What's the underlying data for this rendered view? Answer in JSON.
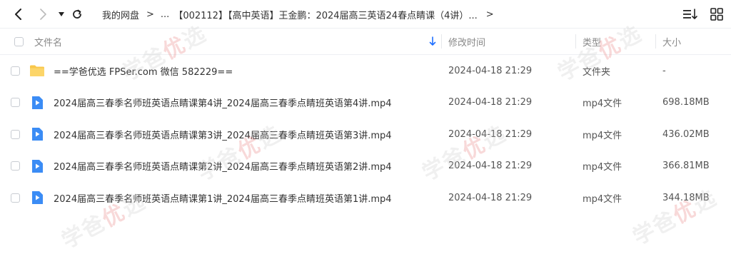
{
  "toolbar": {
    "breadcrumb": [
      {
        "label": "我的网盘"
      },
      {
        "label": "..."
      },
      {
        "label": "【002112】【高中英语】王金鹏：2024届高三英语24春点睛课（4讲）..."
      }
    ],
    "sort_icon": "sort-list-icon",
    "grid_icon": "grid-view-icon"
  },
  "columns": {
    "name": "文件名",
    "modified": "修改时间",
    "type": "类型",
    "size": "大小"
  },
  "files": [
    {
      "name": "==学爸优选 FPSer.com 微信 582229==",
      "modified": "2024-04-18 21:29",
      "type": "文件夹",
      "size": "-",
      "icon": "folder-icon"
    },
    {
      "name": "2024届高三春季名师班英语点睛课第4讲_2024届高三春季点睛班英语第4讲.mp4",
      "modified": "2024-04-18 21:29",
      "type": "mp4文件",
      "size": "698.18MB",
      "icon": "video-file-icon"
    },
    {
      "name": "2024届高三春季名师班英语点睛课第3讲_2024届高三春季点睛班英语第3讲.mp4",
      "modified": "2024-04-18 21:29",
      "type": "mp4文件",
      "size": "436.02MB",
      "icon": "video-file-icon"
    },
    {
      "name": "2024届高三春季名师班英语点睛课第2讲_2024届高三春季点睛班英语第2讲.mp4",
      "modified": "2024-04-18 21:29",
      "type": "mp4文件",
      "size": "366.81MB",
      "icon": "video-file-icon"
    },
    {
      "name": "2024届高三春季名师班英语点睛课第1讲_2024届高三春季点睛班英语第1讲.mp4",
      "modified": "2024-04-18 21:29",
      "type": "mp4文件",
      "size": "344.18MB",
      "icon": "video-file-icon"
    }
  ],
  "watermark": {
    "text_a": "学爸",
    "text_b": "优",
    "text_c": "选"
  },
  "colors": {
    "accent": "#1e6fff",
    "folder": "#f9c74a",
    "video": "#3b8cf5"
  }
}
